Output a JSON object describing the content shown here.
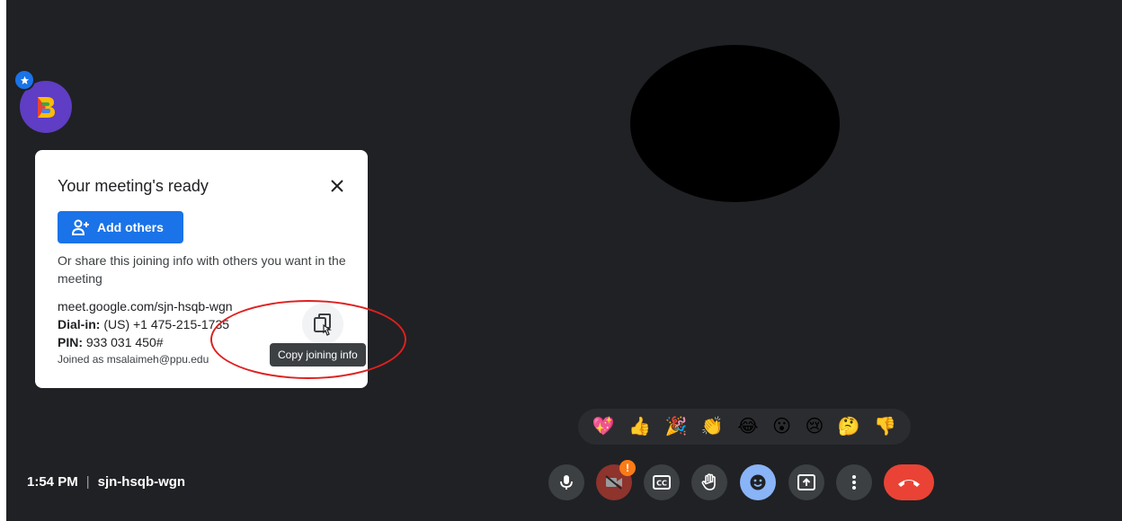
{
  "card": {
    "title": "Your meeting's ready",
    "add_others_label": "Add others",
    "share_text": "Or share this joining info with others you want in the meeting",
    "meet_link": "meet.google.com/sjn-hsqb-wgn",
    "dial_in_label": "Dial-in:",
    "dial_in_value": "(US) +1 475-215-1735",
    "pin_label": "PIN:",
    "pin_value": "933 031 450#",
    "joined_as": "Joined as msalaimeh@ppu.edu",
    "copy_tooltip": "Copy joining info"
  },
  "reactions": [
    "💖",
    "👍",
    "🎉",
    "👏",
    "😂",
    "😮",
    "😢",
    "🤔",
    "👎"
  ],
  "bottom_bar": {
    "time": "1:54 PM",
    "meeting_code": "sjn-hsqb-wgn",
    "camera_alert": "!"
  },
  "colors": {
    "background": "#202124",
    "accent": "#1a73e8",
    "leave": "#ea4335",
    "annotation": "#e02020"
  },
  "icons": [
    "microphone-icon",
    "camera-off-icon",
    "captions-icon",
    "hand-icon",
    "emoji-icon",
    "present-icon",
    "more-icon",
    "hang-up-icon",
    "close-icon",
    "copy-icon",
    "add-person-icon"
  ]
}
